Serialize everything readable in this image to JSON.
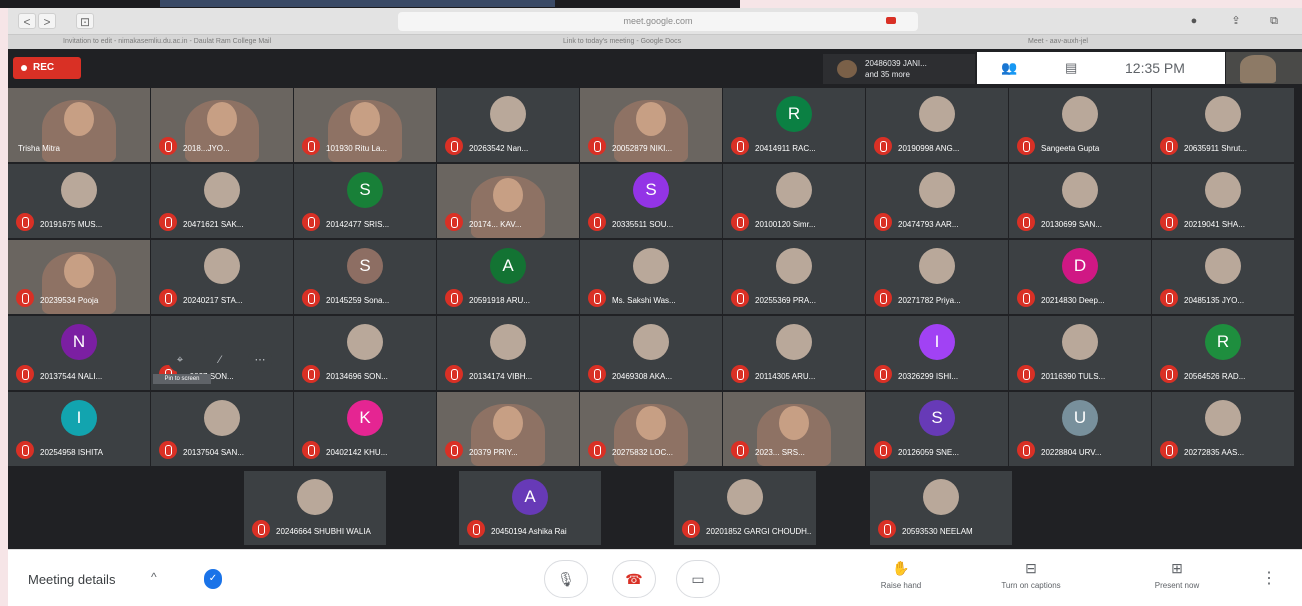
{
  "browser": {
    "nav_back": "<",
    "nav_forward": ">",
    "sidebar": "⊡",
    "url": "meet.google.com",
    "icons": [
      "info-icon",
      "share-icon",
      "tabs-icon"
    ]
  },
  "bookmarks": [
    "Invitation to edit - nimakasemliu.du.ac.in - Daulat Ram College Mail",
    "Link to today's meeting - Google Docs",
    "Meet - aav-auxh-jel"
  ],
  "meet": {
    "rec_label": "REC",
    "presenter_line1": "20486039 JANI...",
    "presenter_line2": "and 35 more",
    "clock": "12:35 PM",
    "icons": [
      "people-icon",
      "chat-icon"
    ]
  },
  "grid": [
    [
      {
        "name": "Trisha Mitra",
        "video": true,
        "muted": false
      },
      {
        "name": "2018...JYO...",
        "video": true,
        "muted": true
      },
      {
        "name": "101930 Ritu La...",
        "video": true,
        "muted": true
      },
      {
        "name": "20263542 Nan...",
        "avatar": "photo",
        "muted": true
      },
      {
        "name": "20052879 NIKI...",
        "video": true,
        "muted": true
      },
      {
        "name": "20414911 RAC...",
        "avatar": "R",
        "color": "#0b8043",
        "muted": true
      },
      {
        "name": "20190998 ANG...",
        "avatar": "photo",
        "muted": true
      },
      {
        "name": "Sangeeta Gupta",
        "avatar": "photo",
        "muted": true
      },
      {
        "name": "20635911 Shrut...",
        "avatar": "photo",
        "muted": true
      }
    ],
    [
      {
        "name": "20191675 MUS...",
        "avatar": "photo",
        "muted": true
      },
      {
        "name": "20471621 SAK...",
        "avatar": "photo",
        "muted": true
      },
      {
        "name": "20142477 SRIS...",
        "avatar": "S",
        "color": "#188038",
        "muted": true
      },
      {
        "name": "20174... KAV...",
        "video": true,
        "muted": true
      },
      {
        "name": "20335511 SOU...",
        "avatar": "S",
        "color": "#9334e6",
        "muted": true
      },
      {
        "name": "20100120 Simr...",
        "avatar": "photo",
        "muted": true
      },
      {
        "name": "20474793 AAR...",
        "avatar": "photo",
        "muted": true
      },
      {
        "name": "20130699 SAN...",
        "avatar": "photo",
        "muted": true
      },
      {
        "name": "20219041 SHA...",
        "avatar": "photo",
        "muted": true
      }
    ],
    [
      {
        "name": "20239534 Pooja",
        "video": true,
        "muted": true
      },
      {
        "name": "20240217 STA...",
        "avatar": "photo",
        "muted": true
      },
      {
        "name": "20145259 Sona...",
        "avatar": "S",
        "color": "#8d6e63",
        "muted": true
      },
      {
        "name": "20591918 ARU...",
        "avatar": "A",
        "color": "#137333",
        "muted": true
      },
      {
        "name": "Ms. Sakshi Was...",
        "avatar": "photo",
        "muted": true
      },
      {
        "name": "20255369 PRA...",
        "avatar": "photo",
        "muted": true
      },
      {
        "name": "20271782 Priya...",
        "avatar": "photo",
        "muted": true
      },
      {
        "name": "20214830 Deep...",
        "avatar": "D",
        "color": "#d01884",
        "muted": true
      },
      {
        "name": "20485135 JYO...",
        "avatar": "photo",
        "muted": true
      }
    ],
    [
      {
        "name": "20137544 NALI...",
        "avatar": "N",
        "color": "#7b1fa2",
        "muted": true
      },
      {
        "name": "...0827 SON...",
        "avatar": "",
        "color": "#3c4043",
        "muted": true
      },
      {
        "name": "20134696 SON...",
        "avatar": "photo",
        "muted": true
      },
      {
        "name": "20134174 VIBH...",
        "avatar": "photo",
        "muted": true
      },
      {
        "name": "20469308 AKA...",
        "avatar": "photo",
        "muted": true
      },
      {
        "name": "20114305 ARU...",
        "avatar": "photo",
        "muted": true
      },
      {
        "name": "20326299 ISHI...",
        "avatar": "I",
        "color": "#a142f4",
        "muted": true
      },
      {
        "name": "20116390 TULS...",
        "avatar": "photo",
        "muted": true
      },
      {
        "name": "20564526 RAD...",
        "avatar": "R",
        "color": "#1e8e3e",
        "muted": true
      }
    ],
    [
      {
        "name": "20254958 ISHITA",
        "avatar": "I",
        "color": "#12a4af",
        "muted": true
      },
      {
        "name": "20137504 SAN...",
        "avatar": "photo",
        "muted": true
      },
      {
        "name": "20402142 KHU...",
        "avatar": "K",
        "color": "#e52592",
        "muted": true
      },
      {
        "name": "20379 PRIY...",
        "video": true,
        "muted": true
      },
      {
        "name": "20275832 LOC...",
        "video": true,
        "muted": true
      },
      {
        "name": "2023... SRS...",
        "video": true,
        "muted": true
      },
      {
        "name": "20126059 SNE...",
        "avatar": "S",
        "color": "#673ab7",
        "muted": true
      },
      {
        "name": "20228804 URV...",
        "avatar": "U",
        "color": "#78909c",
        "muted": true
      },
      {
        "name": "20272835 AAS...",
        "avatar": "photo",
        "muted": true
      }
    ]
  ],
  "last_row": [
    {
      "name": "20246664 SHUBHI WALIA",
      "avatar": "photo",
      "muted": true
    },
    {
      "name": "20450194 Ashika Rai",
      "avatar": "A",
      "color": "#673ab7",
      "muted": true
    },
    {
      "name": "20201852 GARGI CHOUDH...",
      "avatar": "photo",
      "muted": true
    },
    {
      "name": "20593530 NEELAM",
      "avatar": "photo",
      "muted": true
    }
  ],
  "hover": {
    "tooltip": "Pin to screen",
    "icons": [
      "pin-icon",
      "mute-mic-icon",
      "more-icon"
    ]
  },
  "bottom": {
    "meeting_details": "Meeting details",
    "chevron": "^",
    "raise_hand": "Raise hand",
    "captions": "Turn on captions",
    "present": "Present now"
  }
}
